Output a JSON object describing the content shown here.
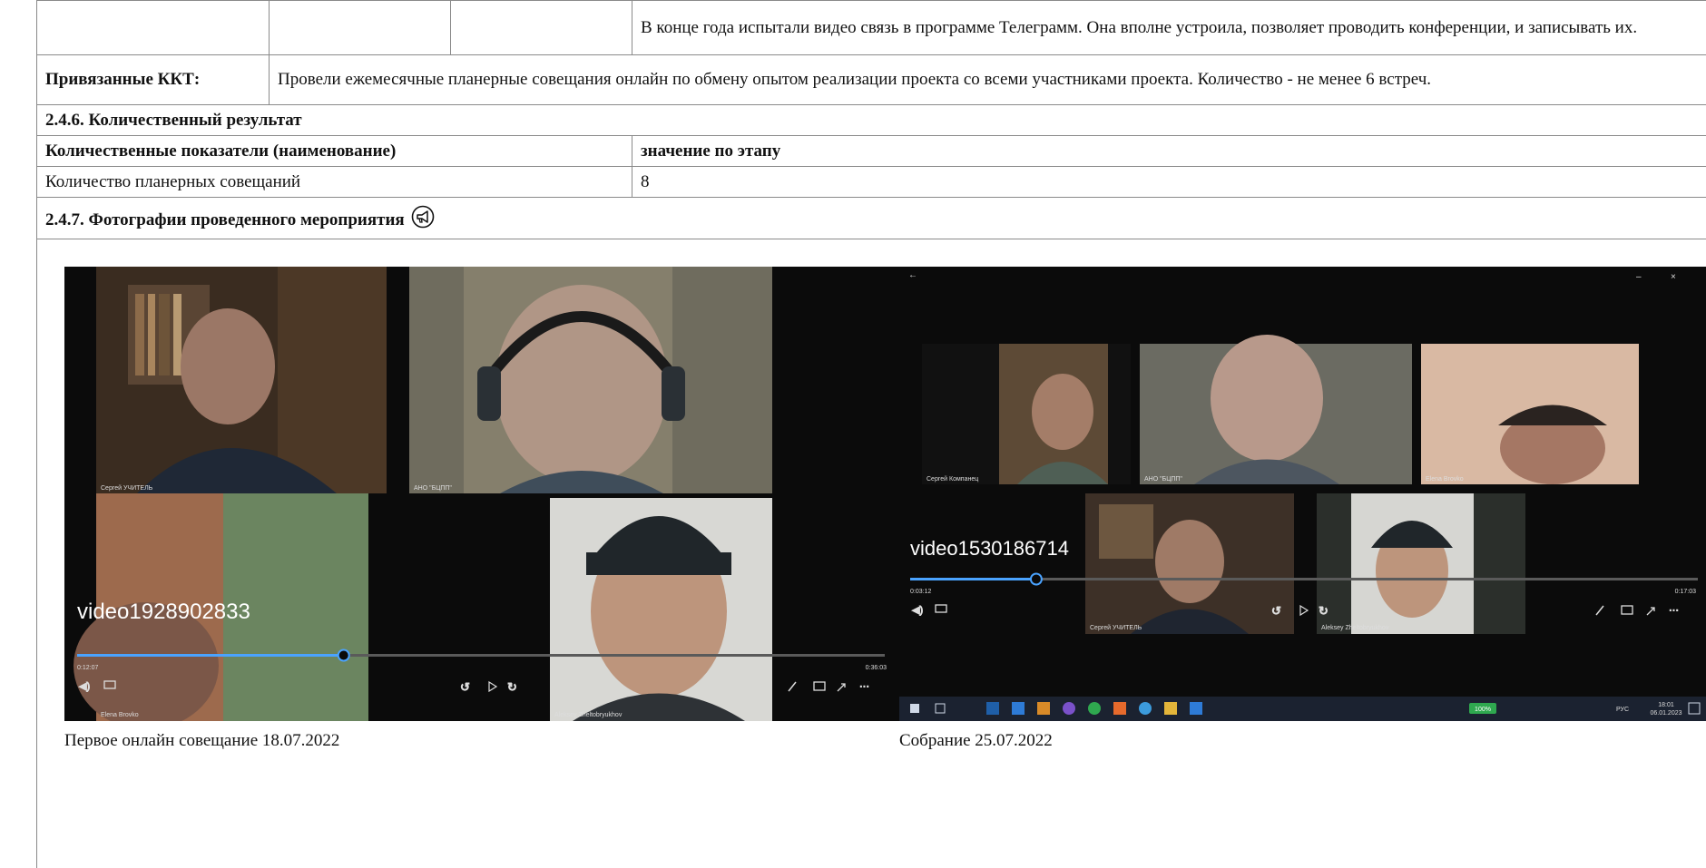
{
  "top_row": {
    "text": "В конце года испытали видео связь в программе Телеграмм. Она вполне устроила, позволяет проводить конференции, и записывать их."
  },
  "linked_kkt": {
    "label": "Привязанные ККТ:",
    "text": "Провели ежемесячные планерные совещания онлайн по обмену опытом реализации проекта со всеми участниками проекта. Количество - не менее 6 встреч."
  },
  "quant_result": {
    "heading": "2.4.6. Количественный результат",
    "col_name_header": "Количественные показатели (наименование)",
    "col_value_header": "значение по этапу",
    "rows": [
      {
        "name": "Количество планерных совещаний",
        "value": "8"
      }
    ]
  },
  "photos_section": {
    "heading": "2.4.7. Фотографии проведенного мероприятия",
    "photos": [
      {
        "caption": "Первое онлайн совещание 18.07.2022",
        "video_label": "video1928902833",
        "time_start": "0:12:07",
        "time_end": "0:36:03",
        "progress": 0.33,
        "participants": [
          "Сергей УЧИТЕЛЬ",
          "АНО \"БЦПП\"",
          "Elena Brovko",
          "Aleksey Zheltobryukhov"
        ]
      },
      {
        "caption": "Собрание 25.07.2022",
        "video_label": "video1530186714",
        "time_start": "0:03:12",
        "time_end": "0:17:03",
        "progress": 0.16,
        "participants": [
          "Сергей Компанец",
          "АНО \"БЦПП\"",
          "Elena Brovko",
          "Сергей УЧИТЕЛЬ",
          "Aleksey Zheltobryukhov"
        ],
        "taskbar": {
          "battery": "100%",
          "lang": "РУС",
          "clock_time": "18:01",
          "clock_date": "06.01.2023"
        }
      }
    ]
  }
}
